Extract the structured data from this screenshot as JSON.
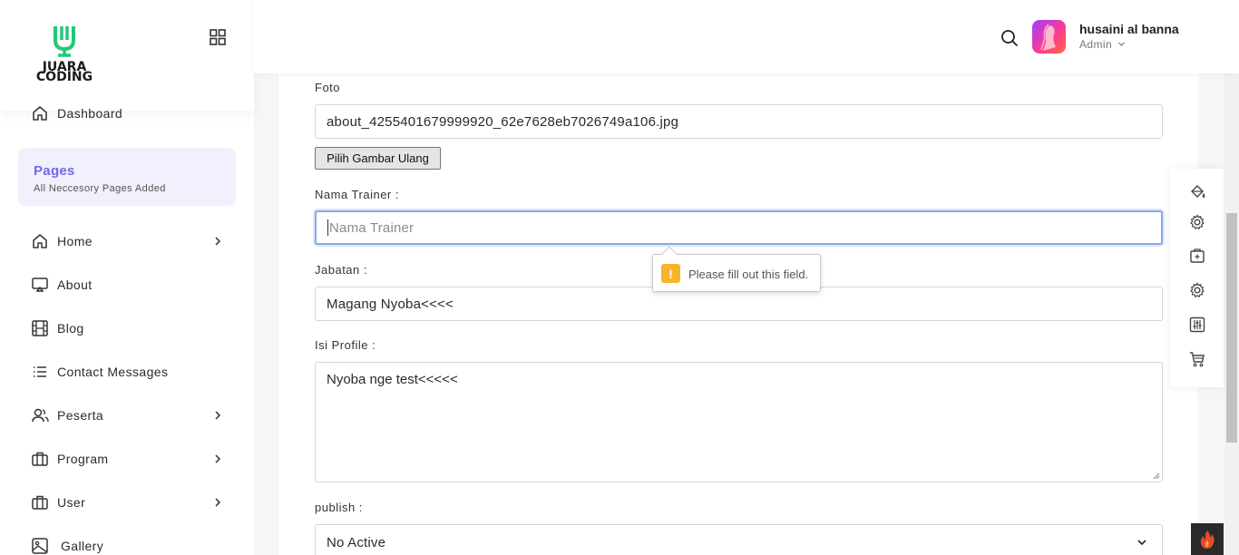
{
  "sidebar": {
    "logo_line1": "JUARA",
    "logo_line2": "CODING",
    "dashboard": "Dashboard",
    "pages_title": "Pages",
    "pages_subtitle": "All Neccesory Pages Added",
    "items": [
      {
        "label": "Home"
      },
      {
        "label": "About"
      },
      {
        "label": "Blog"
      },
      {
        "label": "Contact Messages"
      },
      {
        "label": "Peserta"
      },
      {
        "label": "Program"
      },
      {
        "label": "User"
      },
      {
        "label": "Gallery"
      }
    ]
  },
  "header": {
    "user_name": "husaini al banna",
    "user_role": "Admin"
  },
  "form": {
    "foto_label": "Foto",
    "foto_value": "about_4255401679999920_62e7628eb7026749a106.jpg",
    "file_button": "Pilih Gambar Ulang",
    "nama_label": "Nama Trainer :",
    "nama_placeholder": "Nama Trainer",
    "jabatan_label": "Jabatan :",
    "jabatan_value": "Magang Nyoba<<<<",
    "isi_label": "Isi Profile :",
    "isi_value": "Nyoba nge test<<<<<",
    "publish_label": "publish :",
    "publish_value": "No Active"
  },
  "tooltip": {
    "text": "Please fill out this field.",
    "icon_glyph": "!"
  },
  "colors": {
    "accent": "#7467ef",
    "logo_green": "#22c87a",
    "warning": "#f8b32b",
    "focus": "#86a9e6"
  }
}
